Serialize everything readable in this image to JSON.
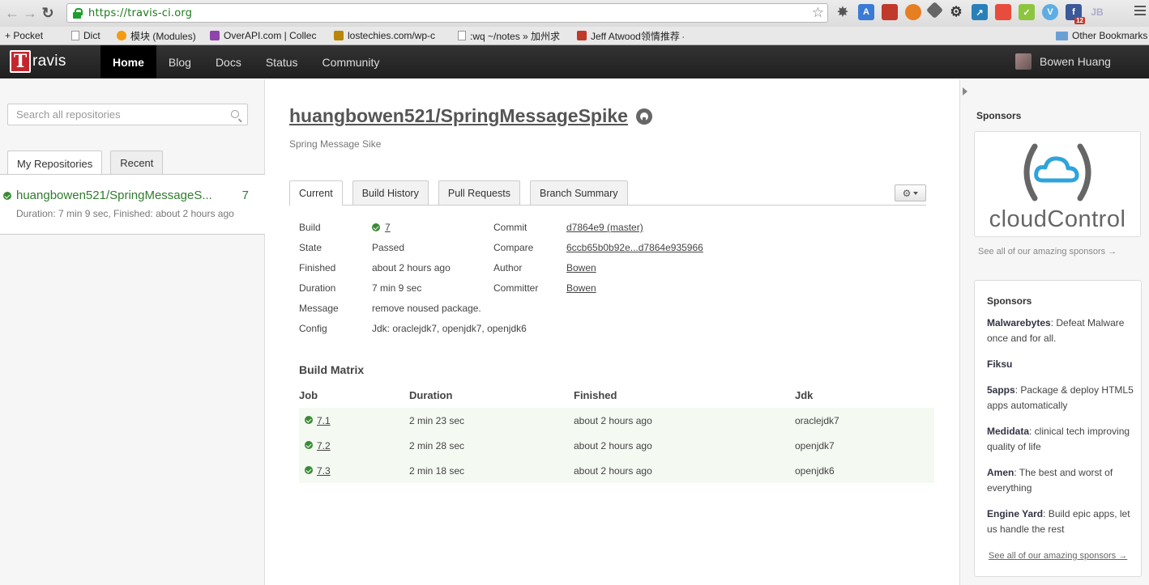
{
  "browser": {
    "url": "https://travis-ci.org",
    "bookmarks": [
      {
        "label": "+ Pocket"
      },
      {
        "label": "Dict"
      },
      {
        "label": "模块 (Modules)"
      },
      {
        "label": "OverAPI.com | Collec"
      },
      {
        "label": "lostechies.com/wp-c"
      },
      {
        "label": ":wq ~/notes » 加州求"
      },
      {
        "label": "Jeff Atwood领情推荐 -"
      },
      {
        "label": "Other Bookmarks"
      }
    ],
    "extension_badge": "12"
  },
  "header": {
    "logo_text": "ravis",
    "logo_letter": "T",
    "nav": [
      {
        "label": "Home"
      },
      {
        "label": "Blog"
      },
      {
        "label": "Docs"
      },
      {
        "label": "Status"
      },
      {
        "label": "Community"
      }
    ],
    "user_name": "Bowen Huang"
  },
  "left": {
    "search_placeholder": "Search all repositories",
    "tabs": [
      {
        "label": "My Repositories"
      },
      {
        "label": "Recent"
      }
    ],
    "repos": [
      {
        "name": "huangbowen521/SpringMessageS...",
        "number": "7",
        "meta": "Duration: 7 min 9 sec, Finished: about 2 hours ago"
      }
    ]
  },
  "main": {
    "title": "huangbowen521/SpringMessageSpike",
    "description": "Spring Message Sike",
    "tabs": [
      {
        "label": "Current"
      },
      {
        "label": "Build History"
      },
      {
        "label": "Pull Requests"
      },
      {
        "label": "Branch Summary"
      }
    ],
    "summary": {
      "build_label": "Build",
      "build_value": "7",
      "state_label": "State",
      "state_value": "Passed",
      "finished_label": "Finished",
      "finished_value": "about 2 hours ago",
      "duration_label": "Duration",
      "duration_value": "7 min 9 sec",
      "message_label": "Message",
      "message_value": "remove noused package.",
      "config_label": "Config",
      "config_value": "Jdk: oraclejdk7, openjdk7, openjdk6",
      "commit_label": "Commit",
      "commit_value": "d7864e9 (master)",
      "compare_label": "Compare",
      "compare_value": "6ccb65b0b92e...d7864e935966",
      "author_label": "Author",
      "author_value": "Bowen",
      "committer_label": "Committer",
      "committer_value": "Bowen"
    },
    "matrix": {
      "title": "Build Matrix",
      "columns": [
        "Job",
        "Duration",
        "Finished",
        "Jdk"
      ],
      "rows": [
        {
          "job": "7.1",
          "duration": "2 min 23 sec",
          "finished": "about 2 hours ago",
          "jdk": "oraclejdk7"
        },
        {
          "job": "7.2",
          "duration": "2 min 28 sec",
          "finished": "about 2 hours ago",
          "jdk": "openjdk7"
        },
        {
          "job": "7.3",
          "duration": "2 min 18 sec",
          "finished": "about 2 hours ago",
          "jdk": "openjdk6"
        }
      ]
    }
  },
  "right": {
    "sponsors_heading": "Sponsors",
    "featured_sponsor": "cloudControl",
    "see_all_top": "See all of our amazing sponsors →",
    "card_title": "Sponsors",
    "entries": [
      {
        "name": "Malwarebytes",
        "text": ": Defeat Malware once and for all."
      },
      {
        "name": "Fiksu",
        "text": ""
      },
      {
        "name": "5apps",
        "text": ": Package & deploy HTML5 apps automatically"
      },
      {
        "name": "Medidata",
        "text": ": clinical tech improving quality of life"
      },
      {
        "name": "Amen",
        "text": ": The best and worst of everything"
      },
      {
        "name": "Engine Yard",
        "text": ": Build epic apps, let us handle the rest"
      }
    ],
    "see_all_bottom": "See all of our amazing sponsors →"
  },
  "colors": {
    "passed_green": "#3b8a36",
    "repo_green": "#317b2f",
    "logo_red": "#c3272d",
    "cloud_blue": "#2ea3dc"
  }
}
